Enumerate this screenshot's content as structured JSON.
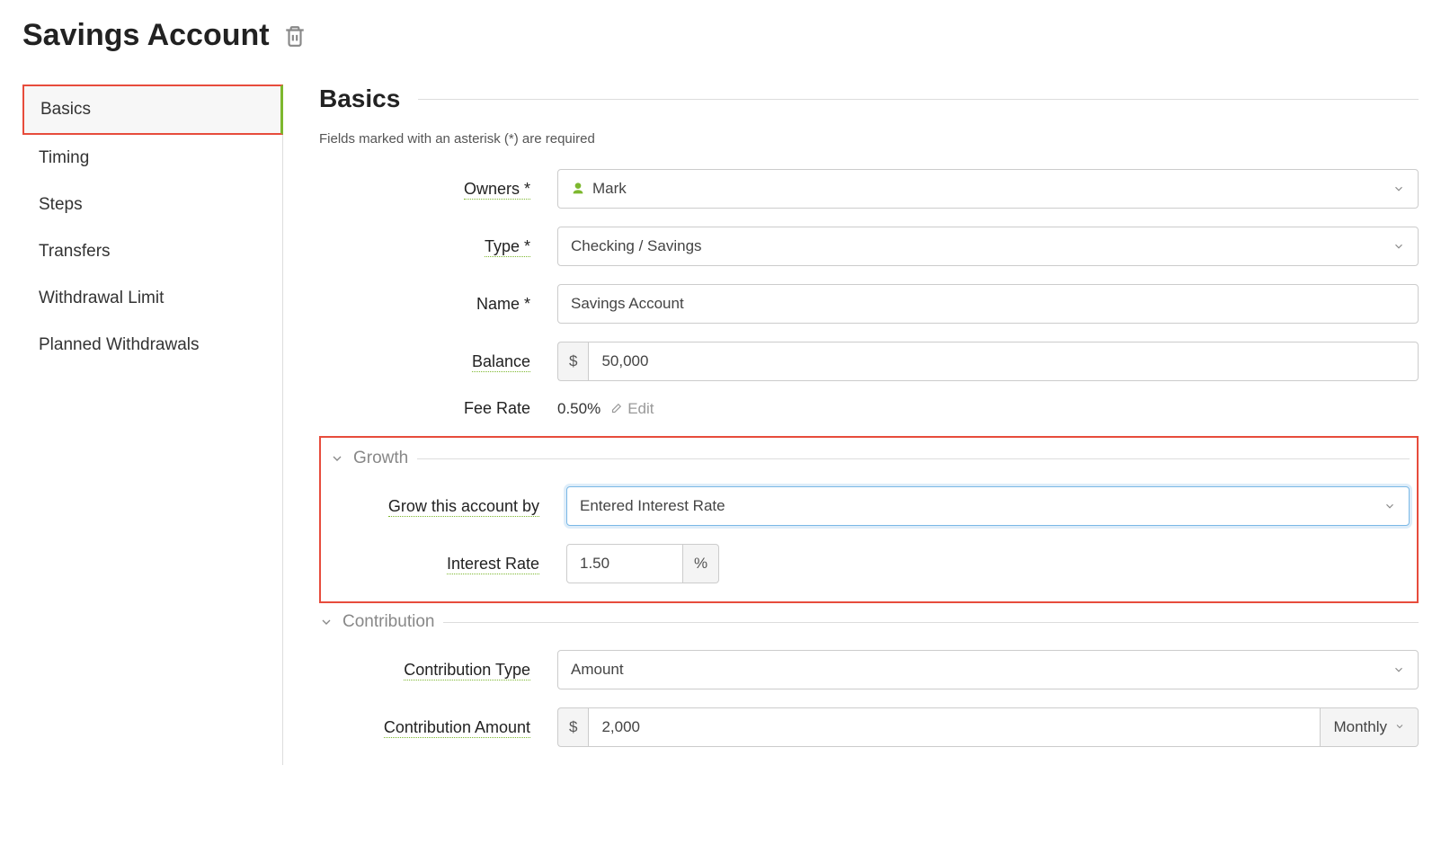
{
  "page": {
    "title": "Savings Account"
  },
  "sidebar": {
    "items": [
      {
        "label": "Basics",
        "active": true
      },
      {
        "label": "Timing",
        "active": false
      },
      {
        "label": "Steps",
        "active": false
      },
      {
        "label": "Transfers",
        "active": false
      },
      {
        "label": "Withdrawal Limit",
        "active": false
      },
      {
        "label": "Planned Withdrawals",
        "active": false
      }
    ]
  },
  "section": {
    "title": "Basics",
    "required_note": "Fields marked with an asterisk (*) are required"
  },
  "form": {
    "owners": {
      "label": "Owners *",
      "value": "Mark"
    },
    "type": {
      "label": "Type *",
      "value": "Checking / Savings"
    },
    "name": {
      "label": "Name *",
      "value": "Savings Account"
    },
    "balance": {
      "label": "Balance",
      "currency": "$",
      "value": "50,000"
    },
    "fee_rate": {
      "label": "Fee Rate",
      "value": "0.50%",
      "edit_label": "Edit"
    }
  },
  "growth": {
    "section_title": "Growth",
    "grow_by": {
      "label": "Grow this account by",
      "value": "Entered Interest Rate"
    },
    "interest_rate": {
      "label": "Interest Rate",
      "value": "1.50",
      "suffix": "%"
    }
  },
  "contribution": {
    "section_title": "Contribution",
    "type": {
      "label": "Contribution Type",
      "value": "Amount"
    },
    "amount": {
      "label": "Contribution Amount",
      "currency": "$",
      "value": "2,000",
      "frequency": "Monthly"
    }
  }
}
